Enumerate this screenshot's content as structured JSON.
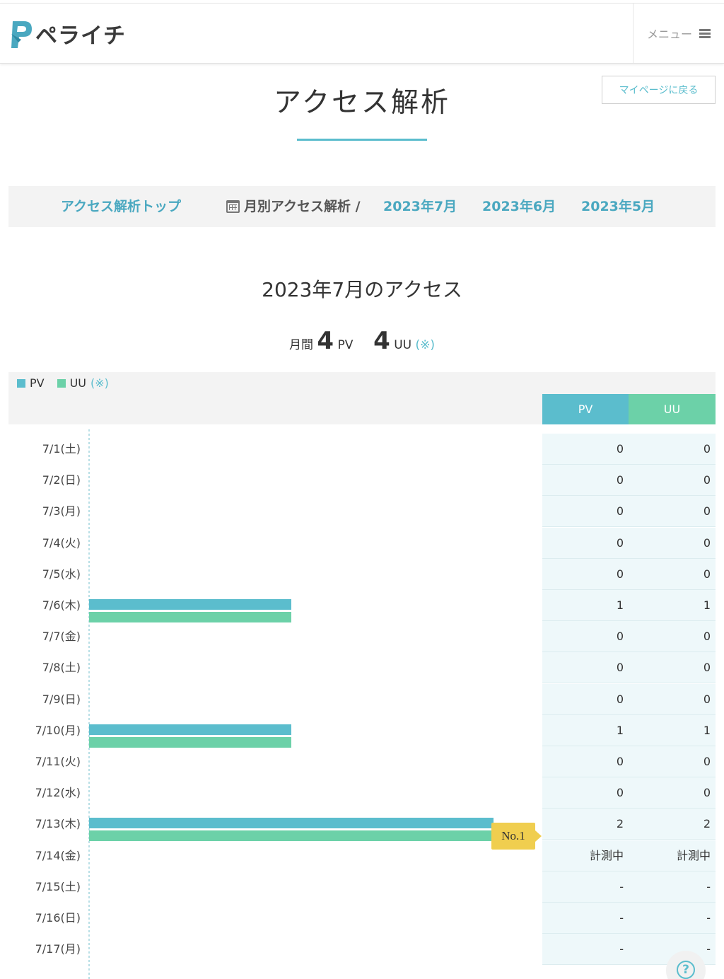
{
  "header": {
    "logo_text": "ペライチ",
    "menu_label": "メニュー"
  },
  "page": {
    "title": "アクセス解析",
    "back_button": "マイページに戻る"
  },
  "nav": {
    "top_link": "アクセス解析トップ",
    "monthly_label": "月別アクセス解析 /",
    "months": [
      "2023年7月",
      "2023年6月",
      "2023年5月"
    ]
  },
  "summary": {
    "title": "2023年7月のアクセス",
    "prefix": "月間",
    "pv_value": "4",
    "pv_unit": "PV",
    "uu_value": "4",
    "uu_unit": "UU",
    "note": "(※)"
  },
  "legend": {
    "pv": "PV",
    "uu": "UU",
    "note": "(※)"
  },
  "table": {
    "headers": {
      "pv": "PV",
      "uu": "UU"
    },
    "badge_label": "No.1"
  },
  "colors": {
    "pv": "#5bbdcd",
    "uu": "#6cd1a8",
    "badge": "#f0ce4f"
  },
  "chart_data": {
    "type": "bar",
    "orientation": "horizontal",
    "categories": [
      "7/1(土)",
      "7/2(日)",
      "7/3(月)",
      "7/4(火)",
      "7/5(水)",
      "7/6(木)",
      "7/7(金)",
      "7/8(土)",
      "7/9(日)",
      "7/10(月)",
      "7/11(火)",
      "7/12(水)",
      "7/13(木)",
      "7/14(金)",
      "7/15(土)",
      "7/16(日)",
      "7/17(月)"
    ],
    "series": [
      {
        "name": "PV",
        "values": [
          0,
          0,
          0,
          0,
          0,
          1,
          0,
          0,
          0,
          1,
          0,
          0,
          2,
          null,
          null,
          null,
          null
        ]
      },
      {
        "name": "UU",
        "values": [
          0,
          0,
          0,
          0,
          0,
          1,
          0,
          0,
          0,
          1,
          0,
          0,
          2,
          null,
          null,
          null,
          null
        ]
      }
    ],
    "display": {
      "pv": [
        "0",
        "0",
        "0",
        "0",
        "0",
        "1",
        "0",
        "0",
        "0",
        "1",
        "0",
        "0",
        "2",
        "計測中",
        "-",
        "-",
        "-"
      ],
      "uu": [
        "0",
        "0",
        "0",
        "0",
        "0",
        "1",
        "0",
        "0",
        "0",
        "1",
        "0",
        "0",
        "2",
        "計測中",
        "-",
        "-",
        "-"
      ]
    },
    "xlim": [
      0,
      2
    ],
    "top_rank_index": 12
  }
}
